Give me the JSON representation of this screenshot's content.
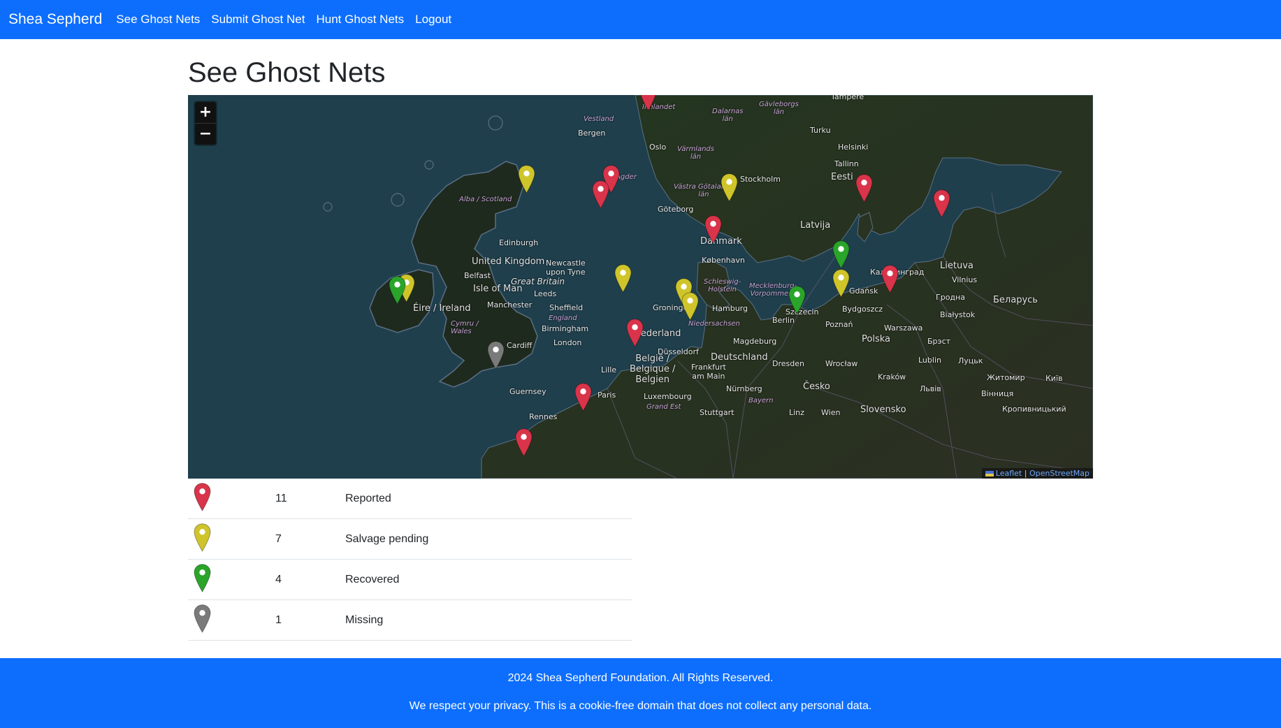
{
  "navbar": {
    "brand": "Shea Sepherd",
    "links": [
      "See Ghost Nets",
      "Submit Ghost Net",
      "Hunt Ghost Nets",
      "Logout"
    ]
  },
  "page": {
    "title": "See Ghost Nets"
  },
  "map": {
    "zoom_in": "+",
    "zoom_out": "−",
    "attribution_leaflet": "Leaflet",
    "attribution_sep": "|",
    "attribution_osm": "OpenStreetMap",
    "colors": {
      "reported": "#d9344a",
      "salvage_pending": "#cfc52a",
      "recovered": "#2aa52a",
      "missing": "#7a7a7a"
    },
    "labels": {
      "tampere": "Tampere",
      "innlandet": "Innlandet",
      "dalarnas": "Dalarnas\nlän",
      "gavleborgs": "Gävleborgs\nlän",
      "vestland": "Vestland",
      "bergen": "Bergen",
      "turku": "Turku",
      "helsinki": "Helsinki",
      "oslo": "Oslo",
      "varmlands": "Värmlands\nlän",
      "tallinn": "Tallinn",
      "stockholm": "Stockholm",
      "eesti": "Eesti",
      "agder": "Agder",
      "vastra": "Västra Götalands\nlän",
      "goteborg": "Göteborg",
      "alba": "Alba / Scotland",
      "latvija": "Latvija",
      "danmark": "Danmark",
      "edinburgh": "Edinburgh",
      "united_kingdom": "United Kingdom",
      "newcastle": "Newcastle\nupon Tyne",
      "belfast": "Belfast",
      "great_britain": "Great Britain",
      "isle_of_man": "Isle of Man",
      "kobenhavn": "København",
      "kaliningrad": "Калининград",
      "lietuva": "Lietuva",
      "vilnius": "Vilnius",
      "schleswig": "Schleswig-\nHolstein",
      "mecklenburg": "Mecklenburg-\nVorpommern",
      "leeds": "Leeds",
      "eire": "Éire / Ireland",
      "manchester": "Manchester",
      "sheffield": "Sheffield",
      "groningen": "Groningen",
      "hamburg": "Hamburg",
      "gdansk": "Gdańsk",
      "hrodna": "Гродна",
      "belarus": "Беларусь",
      "szczecin": "Szczecin",
      "bydgoszcz": "Bydgoszcz",
      "bialystok": "Białystok",
      "england": "England",
      "birmingham": "Birmingham",
      "niedersachsen": "Niedersachsen",
      "berlin": "Berlin",
      "poznan": "Poznań",
      "warszawa": "Warszawa",
      "nederland": "Nederland",
      "polska": "Polska",
      "cardiff": "Cardiff",
      "london": "London",
      "magdeburg": "Magdeburg",
      "brest": "Брэст",
      "dusseldorf": "Düsseldorf",
      "deutschland": "Deutschland",
      "dresden": "Dresden",
      "wroclaw": "Wrocław",
      "lublin": "Lublin",
      "lutsk": "Луцьк",
      "belgie": "België /\nBelgique /\nBelgien",
      "frankfurt": "Frankfurt\nam Main",
      "lille": "Lille",
      "krakow": "Kraków",
      "zhytomyr": "Житомир",
      "kyiv": "Київ",
      "cesko": "Česko",
      "nurnberg": "Nürnberg",
      "lviv": "Львів",
      "vinnytsia": "Вінниця",
      "guernsey": "Guernsey",
      "paris": "Paris",
      "luxembourg": "Luxembourg",
      "bayern": "Bayern",
      "grand_est": "Grand Est",
      "stuttgart": "Stuttgart",
      "linz": "Linz",
      "wien": "Wien",
      "slovensko": "Slovensko",
      "rennes": "Rennes",
      "kropyvnytskyi": "Кропивницький",
      "cymru": "Cymru /\nWales"
    }
  },
  "legend": [
    {
      "status": "reported",
      "count": "11",
      "label": "Reported"
    },
    {
      "status": "salvage_pending",
      "count": "7",
      "label": "Salvage pending"
    },
    {
      "status": "recovered",
      "count": "4",
      "label": "Recovered"
    },
    {
      "status": "missing",
      "count": "1",
      "label": "Missing"
    }
  ],
  "footer": {
    "copyright": "2024 Shea Sepherd Foundation. All Rights Reserved.",
    "privacy": "We respect your privacy. This is a cookie-free domain that does not collect any personal data."
  }
}
